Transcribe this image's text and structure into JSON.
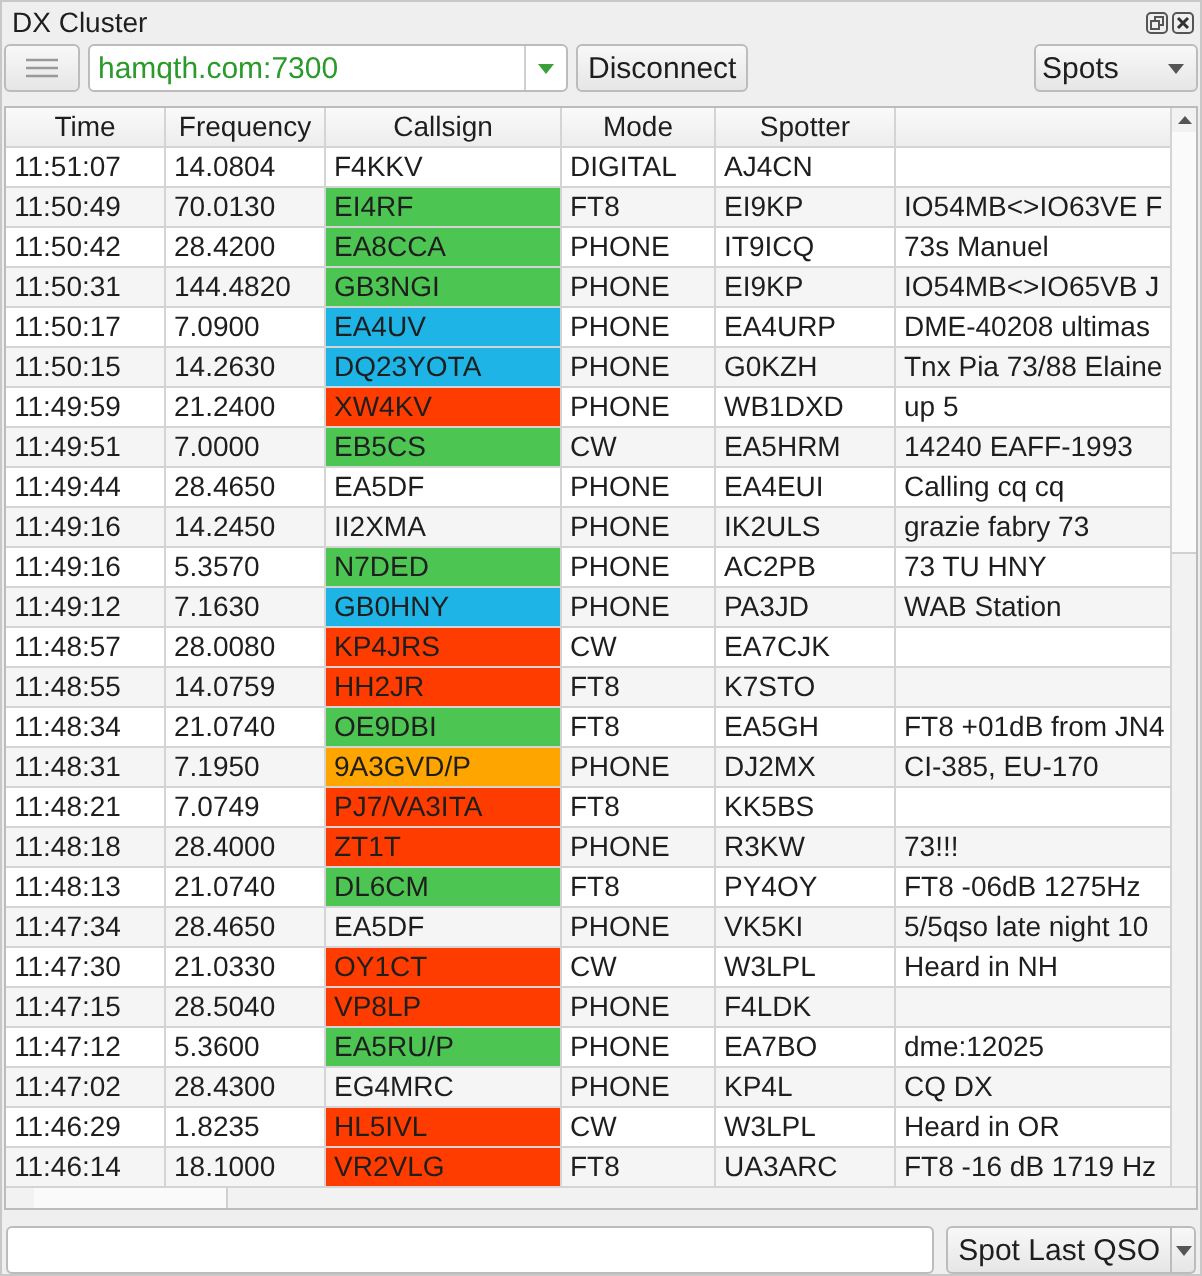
{
  "window": {
    "title": "DX Cluster"
  },
  "toolbar": {
    "server": "hamqth.com:7300",
    "connect_button": "Disconnect",
    "view_select": "Spots"
  },
  "table": {
    "columns": [
      "Time",
      "Frequency",
      "Callsign",
      "Mode",
      "Spotter"
    ],
    "rows": [
      {
        "time": "11:51:07",
        "frequency": "14.0804",
        "callsign": "F4KKV",
        "mode": "DIGITAL",
        "spotter": "AJ4CN"
      },
      {
        "time": "11:50:49",
        "frequency": "70.0130",
        "callsign": "EI4RF",
        "color": "#4cc552",
        "mode": "FT8",
        "spotter": "EI9KP",
        "comment": "IO54MB<>IO63VE F"
      },
      {
        "time": "11:50:42",
        "frequency": "28.4200",
        "callsign": "EA8CCA",
        "color": "#4cc552",
        "mode": "PHONE",
        "spotter": "IT9ICQ",
        "comment": "73s Manuel"
      },
      {
        "time": "11:50:31",
        "frequency": "144.4820",
        "callsign": "GB3NGI",
        "color": "#4cc552",
        "mode": "PHONE",
        "spotter": "EI9KP",
        "comment": "IO54MB<>IO65VB J"
      },
      {
        "time": "11:50:17",
        "frequency": "7.0900",
        "callsign": "EA4UV",
        "color": "#1eb4e6",
        "mode": "PHONE",
        "spotter": "EA4URP",
        "comment": "DME-40208 ultimas"
      },
      {
        "time": "11:50:15",
        "frequency": "14.2630",
        "callsign": "DQ23YOTA",
        "color": "#1eb4e6",
        "mode": "PHONE",
        "spotter": "G0KZH",
        "comment": "Tnx Pia 73/88 Elaine"
      },
      {
        "time": "11:49:59",
        "frequency": "21.2400",
        "callsign": "XW4KV",
        "color": "#ff3c00",
        "mode": "PHONE",
        "spotter": "WB1DXD",
        "comment": "up 5"
      },
      {
        "time": "11:49:51",
        "frequency": "7.0000",
        "callsign": "EB5CS",
        "color": "#4cc552",
        "mode": "CW",
        "spotter": "EA5HRM",
        "comment": "14240 EAFF-1993"
      },
      {
        "time": "11:49:44",
        "frequency": "28.4650",
        "callsign": "EA5DF",
        "mode": "PHONE",
        "spotter": "EA4EUI",
        "comment": "Calling cq cq"
      },
      {
        "time": "11:49:16",
        "frequency": "14.2450",
        "callsign": "II2XMA",
        "mode": "PHONE",
        "spotter": "IK2ULS",
        "comment": "grazie fabry 73"
      },
      {
        "time": "11:49:16",
        "frequency": "5.3570",
        "callsign": "N7DED",
        "color": "#4cc552",
        "mode": "PHONE",
        "spotter": "AC2PB",
        "comment": "73 TU HNY"
      },
      {
        "time": "11:49:12",
        "frequency": "7.1630",
        "callsign": "GB0HNY",
        "color": "#1eb4e6",
        "mode": "PHONE",
        "spotter": "PA3JD",
        "comment": "WAB Station"
      },
      {
        "time": "11:48:57",
        "frequency": "28.0080",
        "callsign": "KP4JRS",
        "color": "#ff3c00",
        "mode": "CW",
        "spotter": "EA7CJK"
      },
      {
        "time": "11:48:55",
        "frequency": "14.0759",
        "callsign": "HH2JR",
        "color": "#ff3c00",
        "mode": "FT8",
        "spotter": "K7STO"
      },
      {
        "time": "11:48:34",
        "frequency": "21.0740",
        "callsign": "OE9DBI",
        "color": "#4cc552",
        "mode": "FT8",
        "spotter": "EA5GH",
        "comment": "FT8 +01dB from JN4"
      },
      {
        "time": "11:48:31",
        "frequency": "7.1950",
        "callsign": "9A3GVD/P",
        "color": "#ffa500",
        "mode": "PHONE",
        "spotter": "DJ2MX",
        "comment": "CI-385, EU-170"
      },
      {
        "time": "11:48:21",
        "frequency": "7.0749",
        "callsign": "PJ7/VA3ITA",
        "color": "#ff3c00",
        "mode": "FT8",
        "spotter": "KK5BS"
      },
      {
        "time": "11:48:18",
        "frequency": "28.4000",
        "callsign": "ZT1T",
        "color": "#ff3c00",
        "mode": "PHONE",
        "spotter": "R3KW",
        "comment": "73!!!"
      },
      {
        "time": "11:48:13",
        "frequency": "21.0740",
        "callsign": "DL6CM",
        "color": "#4cc552",
        "mode": "FT8",
        "spotter": "PY4OY",
        "comment": "FT8 -06dB 1275Hz"
      },
      {
        "time": "11:47:34",
        "frequency": "28.4650",
        "callsign": "EA5DF",
        "mode": "PHONE",
        "spotter": "VK5KI",
        "comment": "5/5qso late night 10"
      },
      {
        "time": "11:47:30",
        "frequency": "21.0330",
        "callsign": "OY1CT",
        "color": "#ff3c00",
        "mode": "CW",
        "spotter": "W3LPL",
        "comment": "Heard in NH"
      },
      {
        "time": "11:47:15",
        "frequency": "28.5040",
        "callsign": "VP8LP",
        "color": "#ff3c00",
        "mode": "PHONE",
        "spotter": "F4LDK"
      },
      {
        "time": "11:47:12",
        "frequency": "5.3600",
        "callsign": "EA5RU/P",
        "color": "#4cc552",
        "mode": "PHONE",
        "spotter": "EA7BO",
        "comment": "dme:12025"
      },
      {
        "time": "11:47:02",
        "frequency": "28.4300",
        "callsign": "EG4MRC",
        "mode": "PHONE",
        "spotter": "KP4L",
        "comment": "CQ DX"
      },
      {
        "time": "11:46:29",
        "frequency": "1.8235",
        "callsign": "HL5IVL",
        "color": "#ff3c00",
        "mode": "CW",
        "spotter": "W3LPL",
        "comment": "Heard in OR"
      },
      {
        "time": "11:46:14",
        "frequency": "18.1000",
        "callsign": "VR2VLG",
        "color": "#ff3c00",
        "mode": "FT8",
        "spotter": "UA3ARC",
        "comment": "FT8 -16 dB 1719 Hz"
      }
    ]
  },
  "bottom": {
    "spot_button": "Spot Last QSO"
  }
}
